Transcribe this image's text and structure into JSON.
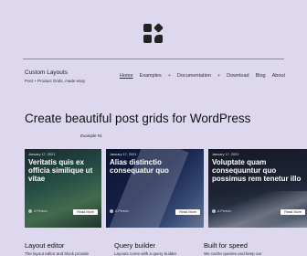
{
  "site": {
    "title": "Custom Layouts",
    "tagline": "Post + Product Grids, made easy"
  },
  "nav": {
    "items": [
      {
        "label": "Home",
        "active": true
      },
      {
        "label": "Examples",
        "active": false
      },
      {
        "label": "+",
        "active": false
      },
      {
        "label": "Documentation",
        "active": false
      },
      {
        "label": "+",
        "active": false
      },
      {
        "label": "Download",
        "active": false
      },
      {
        "label": "Blog",
        "active": false
      },
      {
        "label": "About",
        "active": false
      }
    ]
  },
  "hero": {
    "headline": "Create beautiful post grids for WordPress",
    "example_label": "Example #1"
  },
  "cards": [
    {
      "date": "January 17, 2021",
      "title": "Veritatis quis ex officia similique ut vitae",
      "author": "A Person",
      "more": "Read More"
    },
    {
      "date": "January 17, 2021",
      "title": "Alias distinctio consequatur quo",
      "author": "A Person",
      "more": "Read More"
    },
    {
      "date": "January 17, 2021",
      "title": "Voluptate quam consequuntur quo possimus rem tenetur illo",
      "author": "A Person",
      "more": "Read More"
    }
  ],
  "features": [
    {
      "title": "Layout editor",
      "desc": "The layout editor and block provide"
    },
    {
      "title": "Query builder",
      "desc": "Layouts come with a query builder"
    },
    {
      "title": "Built for speed",
      "desc": "We cache queries and keep our"
    }
  ]
}
